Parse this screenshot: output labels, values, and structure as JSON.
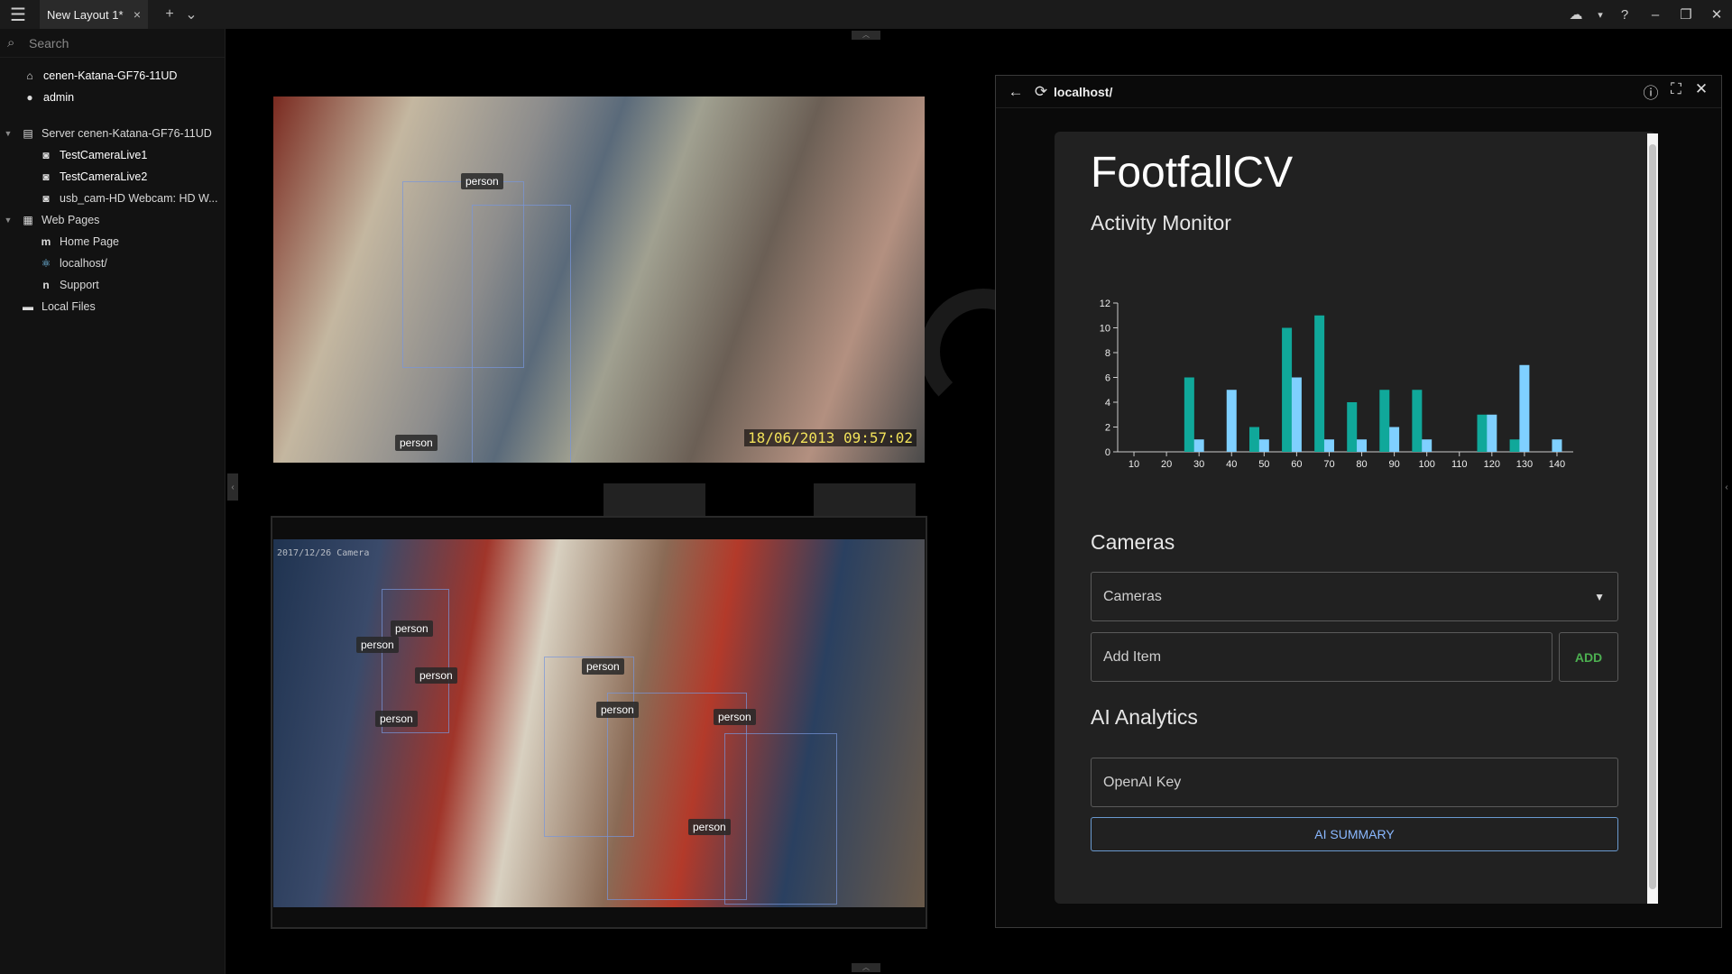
{
  "titlebar": {
    "tab_label": "New Layout 1*",
    "tab_close": "×",
    "add_tab": "+",
    "tab_menu": "⌄"
  },
  "sidebar": {
    "search_placeholder": "Search",
    "items": [
      {
        "label": "cenen-Katana-GF76-11UD",
        "icon": "home-icon"
      },
      {
        "label": "admin",
        "icon": "user-icon"
      },
      {
        "label": "Server cenen-Katana-GF76-11UD",
        "icon": "server-icon"
      },
      {
        "label": "TestCameraLive1",
        "icon": "camera-icon"
      },
      {
        "label": "TestCameraLive2",
        "icon": "camera-icon"
      },
      {
        "label": "usb_cam-HD Webcam: HD W...",
        "icon": "camera-icon"
      },
      {
        "label": "Web Pages",
        "icon": "web-pages-icon"
      },
      {
        "label": "Home Page",
        "icon": "m-icon"
      },
      {
        "label": "localhost/",
        "icon": "react-icon"
      },
      {
        "label": "Support",
        "icon": "nx-icon"
      },
      {
        "label": "Local Files",
        "icon": "folder-icon"
      }
    ]
  },
  "camera1": {
    "labels": [
      "person",
      "person"
    ],
    "timestamp": "18/06/2013 09:57:02"
  },
  "camera2": {
    "timestamp": "2017/12/26 Camera",
    "labels": [
      "person",
      "person",
      "person",
      "person",
      "person",
      "person",
      "person",
      "person"
    ]
  },
  "browser": {
    "url": "localhost/",
    "title": "FootfallCV",
    "subtitle": "Activity Monitor",
    "cameras_heading": "Cameras",
    "cameras_select": "Cameras",
    "add_item_placeholder": "Add Item",
    "add_button": "ADD",
    "ai_heading": "AI Analytics",
    "openai_placeholder": "OpenAI Key",
    "ai_summary_button": "AI SUMMARY"
  },
  "colors": {
    "series_a": "#10a89a",
    "series_b": "#7fd0ff",
    "accent_green": "#4caf50",
    "accent_blue": "#8ab8ff"
  },
  "chart_data": {
    "type": "bar",
    "x_ticks": [
      10,
      20,
      30,
      40,
      50,
      60,
      70,
      80,
      90,
      100,
      110,
      120,
      130,
      140
    ],
    "y_ticks": [
      0,
      2,
      4,
      6,
      8,
      10,
      12
    ],
    "ylim": [
      0,
      12
    ],
    "xlim": [
      5,
      145
    ],
    "series": [
      {
        "color": "#10a89a",
        "points": [
          {
            "x": 27,
            "y": 6
          },
          {
            "x": 47,
            "y": 2
          },
          {
            "x": 57,
            "y": 10
          },
          {
            "x": 67,
            "y": 11
          },
          {
            "x": 77,
            "y": 4
          },
          {
            "x": 87,
            "y": 5
          },
          {
            "x": 97,
            "y": 5
          },
          {
            "x": 117,
            "y": 3
          },
          {
            "x": 127,
            "y": 1
          }
        ]
      },
      {
        "color": "#7fd0ff",
        "points": [
          {
            "x": 30,
            "y": 1
          },
          {
            "x": 40,
            "y": 5
          },
          {
            "x": 50,
            "y": 1
          },
          {
            "x": 60,
            "y": 6
          },
          {
            "x": 70,
            "y": 1
          },
          {
            "x": 80,
            "y": 1
          },
          {
            "x": 90,
            "y": 2
          },
          {
            "x": 100,
            "y": 1
          },
          {
            "x": 120,
            "y": 3
          },
          {
            "x": 130,
            "y": 7
          },
          {
            "x": 140,
            "y": 1
          }
        ]
      }
    ]
  }
}
